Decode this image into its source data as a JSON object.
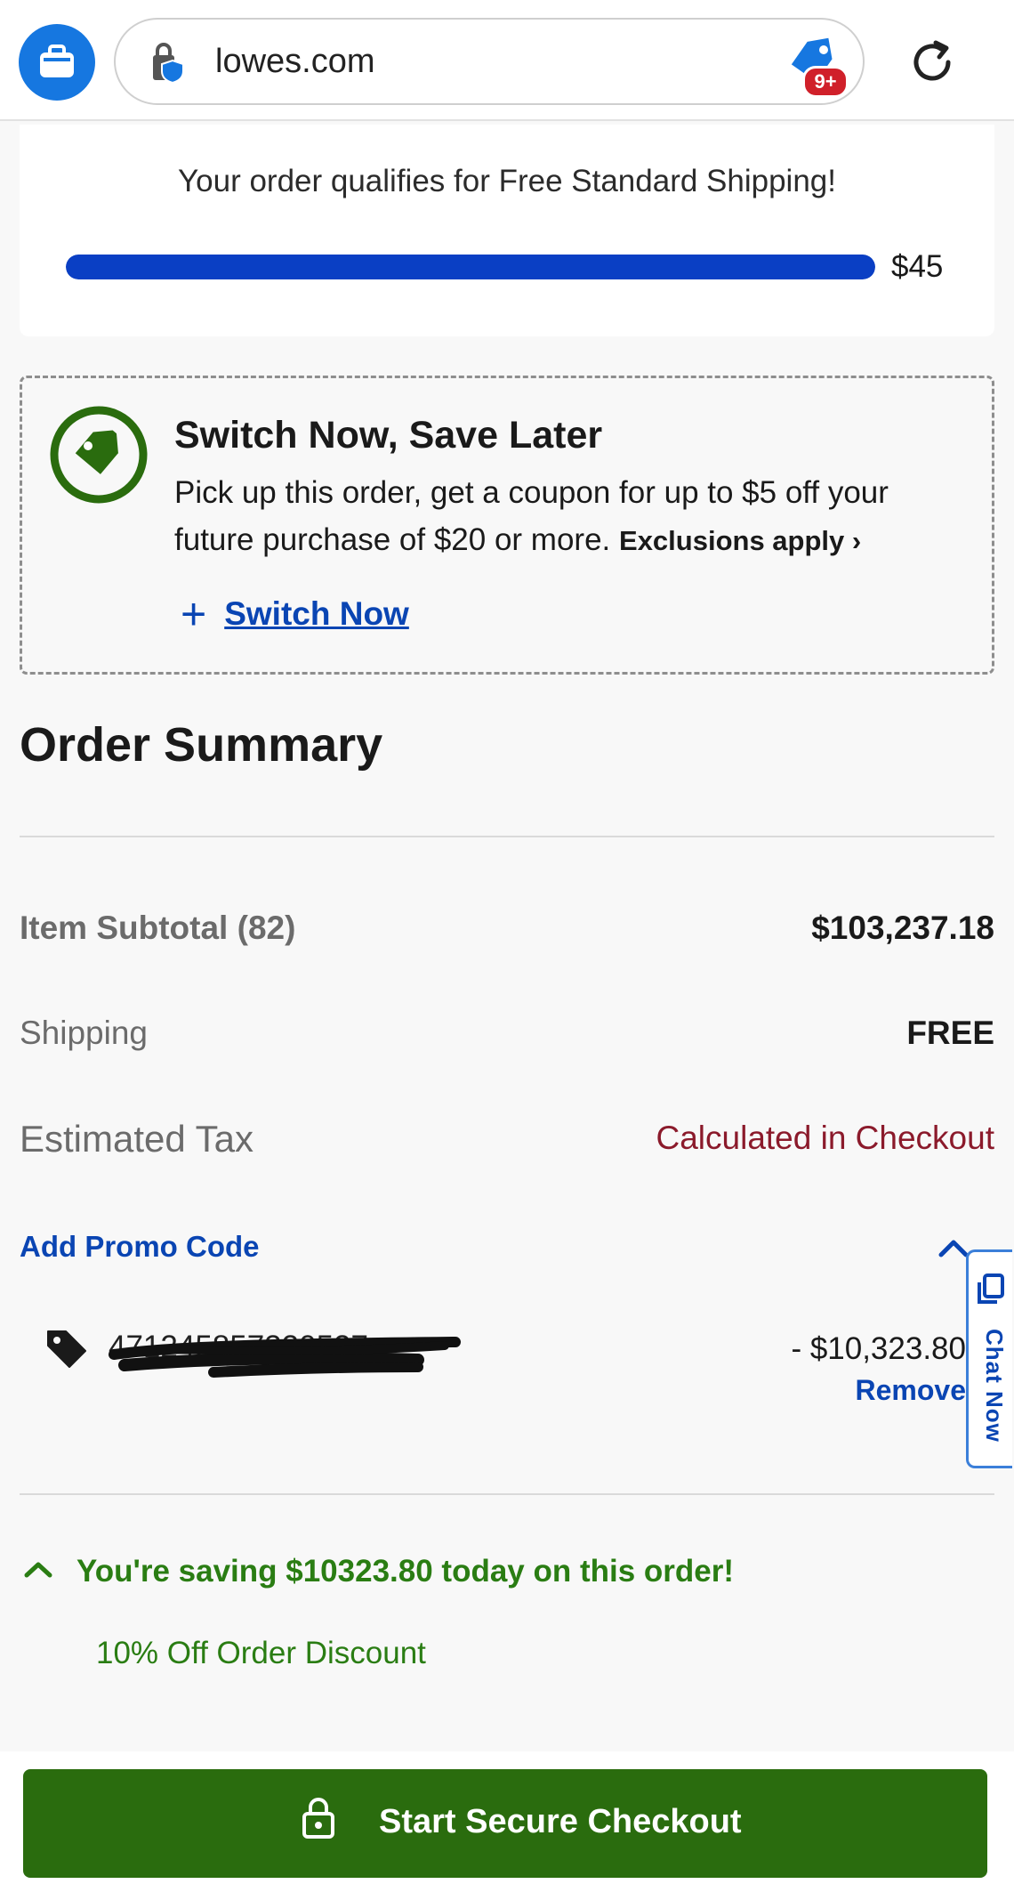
{
  "browser": {
    "url": "lowes.com",
    "extension_badge": "9+"
  },
  "shipping": {
    "message": "Your order qualifies for Free Standard Shipping!",
    "amount": "$45",
    "progress_fraction": 1.0
  },
  "switch_promo": {
    "title": "Switch Now, Save Later",
    "description": "Pick up this order, get a coupon for up to $5 off your future purchase of $20 or more.",
    "exclusions": "Exclusions apply",
    "action_label": "Switch Now"
  },
  "order_summary": {
    "title": "Order Summary",
    "subtotal_label": "Item Subtotal (82)",
    "subtotal_value": "$103,237.18",
    "shipping_label": "Shipping",
    "shipping_value": "FREE",
    "tax_label": "Estimated Tax",
    "tax_value": "Calculated in Checkout",
    "promo_link": "Add Promo Code",
    "promo": {
      "code": "471245857320527",
      "discount": "- $10,323.80",
      "remove_label": "Remove"
    },
    "savings_message": "You're saving $10323.80 today on this order!",
    "discount_name": "10% Off Order Discount"
  },
  "chat": {
    "label": "Chat Now"
  },
  "checkout": {
    "label": "Start Secure Checkout"
  },
  "colors": {
    "brand_blue": "#0a45b3",
    "progress_blue": "#0a3fc4",
    "savings_green": "#2a7d13",
    "checkout_green": "#2a6c0e",
    "tax_red": "#8b1a2b"
  }
}
